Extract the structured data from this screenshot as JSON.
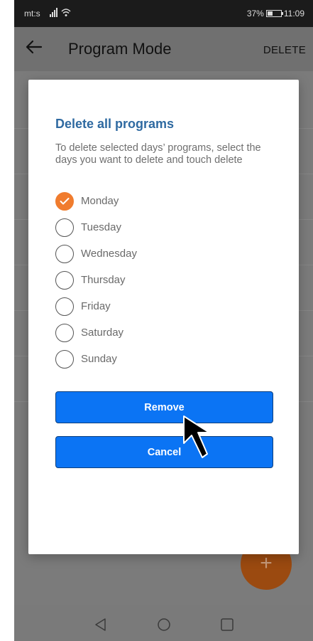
{
  "status_bar": {
    "carrier": "mt:s",
    "battery": "37%",
    "time": "11:09"
  },
  "app_bar": {
    "title": "Program Mode",
    "action": "DELETE"
  },
  "dialog": {
    "title": "Delete all programs",
    "message": "To delete selected days’ programs, select the days you want to delete and touch delete",
    "days": [
      {
        "label": "Monday",
        "checked": true
      },
      {
        "label": "Tuesday",
        "checked": false
      },
      {
        "label": "Wednesday",
        "checked": false
      },
      {
        "label": "Thursday",
        "checked": false
      },
      {
        "label": "Friday",
        "checked": false
      },
      {
        "label": "Saturday",
        "checked": false
      },
      {
        "label": "Sunday",
        "checked": false
      }
    ],
    "remove_label": "Remove",
    "cancel_label": "Cancel"
  },
  "fab": {
    "label": "+"
  },
  "colors": {
    "accent": "#f07c2e",
    "button": "#0b74f4",
    "title": "#2f6aa1"
  },
  "icons": {
    "back": "arrow-left-icon",
    "nav_back": "triangle-back-icon",
    "nav_home": "circle-home-icon",
    "nav_recents": "square-recents-icon",
    "check": "checkmark-icon",
    "pointer": "mouse-cursor-icon"
  }
}
